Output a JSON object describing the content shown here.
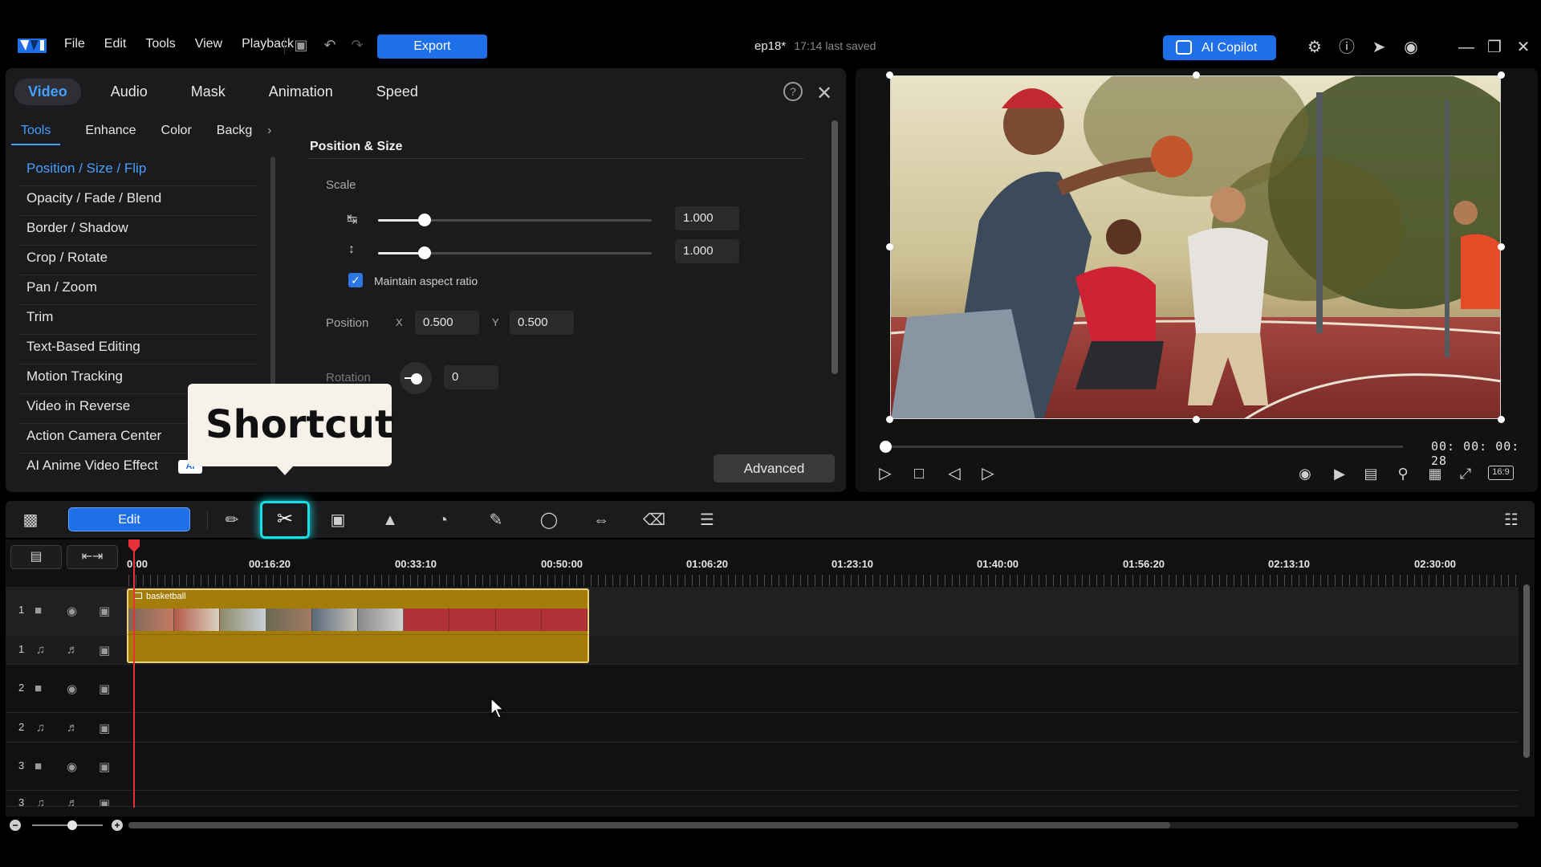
{
  "app": {
    "menu": [
      "File",
      "Edit",
      "Tools",
      "View",
      "Playback"
    ],
    "export_label": "Export",
    "project_name": "ep18*",
    "saved_text": "17:14 last saved",
    "copilot_label": "AI Copilot"
  },
  "panel": {
    "main_tabs": [
      "Video",
      "Audio",
      "Mask",
      "Animation",
      "Speed"
    ],
    "active_main_tab": "Video",
    "sub_tabs": [
      "Tools",
      "Enhance",
      "Color",
      "Backg"
    ],
    "tools": [
      "Position / Size / Flip",
      "Opacity / Fade / Blend",
      "Border / Shadow",
      "Crop / Rotate",
      "Pan / Zoom",
      "Trim",
      "Text-Based Editing",
      "Motion Tracking",
      "Video in Reverse",
      "Action Camera Center",
      "AI Anime Video Effect"
    ],
    "ai_badge": "AI"
  },
  "props": {
    "section_title": "Position & Size",
    "scale_label": "Scale",
    "scale_w": "1.000",
    "scale_h": "1.000",
    "scale_w_level": 0.17,
    "scale_h_level": 0.17,
    "maintain_aspect_label": "Maintain aspect ratio",
    "maintain_aspect_checked": true,
    "position_label": "Position",
    "x_label": "X",
    "x_value": "0.500",
    "y_label": "Y",
    "y_value": "0.500",
    "rotation_label": "Rotation",
    "rotation_value": "0",
    "advanced_label": "Advanced"
  },
  "overlay": {
    "shortcut_text": "Shortcut"
  },
  "preview": {
    "timecode": "00: 00: 00: 28",
    "aspect_ratio": "16:9",
    "progress": 0.0
  },
  "edit_bar": {
    "edit_label": "Edit"
  },
  "timeline": {
    "ruler": [
      "0:00",
      "00:16:20",
      "00:33:10",
      "00:50:00",
      "01:06:20",
      "01:23:10",
      "01:40:00",
      "01:56:20",
      "02:13:10",
      "02:30:00"
    ],
    "tracks": [
      {
        "num": "1",
        "type": "video"
      },
      {
        "num": "1",
        "type": "audio"
      },
      {
        "num": "2",
        "type": "video"
      },
      {
        "num": "2",
        "type": "audio"
      },
      {
        "num": "3",
        "type": "video"
      },
      {
        "num": "3",
        "type": "audio"
      }
    ],
    "clip_name": "basketball"
  },
  "colors": {
    "accent": "#1e6fe8",
    "active_text": "#46a0ff",
    "highlight": "#16e0e6",
    "playhead": "#e8303a",
    "clip": "#a37c0a"
  }
}
